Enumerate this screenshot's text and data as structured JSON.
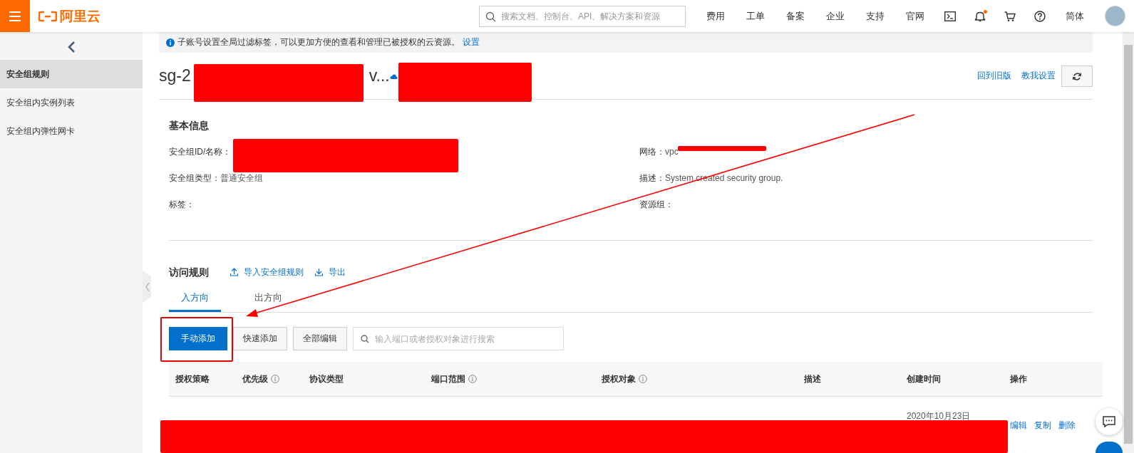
{
  "topbar": {
    "logo_text": "阿里云",
    "search": {
      "placeholder": "搜索文档、控制台、API、解决方案和资源"
    },
    "nav_links": [
      "费用",
      "工单",
      "备案",
      "企业",
      "支持",
      "官网"
    ],
    "notifications": {
      "unread": true
    },
    "language": "简体"
  },
  "sidebar": {
    "items": [
      {
        "label": "安全组规则",
        "selected": true
      },
      {
        "label": "安全组内实例列表",
        "selected": false
      },
      {
        "label": "安全组内弹性网卡",
        "selected": false
      }
    ]
  },
  "notice": {
    "text": "子账号设置全局过滤标签，可以更加方便的查看和管理已被授权的云资源。",
    "link": "设置"
  },
  "header": {
    "title_start": "sg-2",
    "title_end": "v...",
    "links": [
      "回到旧版",
      "教我设置"
    ]
  },
  "basic_info": {
    "title": "基本信息",
    "fields": [
      {
        "label": "安全组ID/名称："
      },
      {
        "label": "网络：",
        "value": "vpc"
      },
      {
        "label": "安全组类型：",
        "value": "普通安全组"
      },
      {
        "label": "描述：",
        "value": "System created security group."
      },
      {
        "label": "标签："
      },
      {
        "label": "资源组："
      }
    ]
  },
  "rules": {
    "title": "访问规则",
    "actions": [
      "导入安全组规则",
      "导出"
    ],
    "tabs": [
      {
        "label": "入方向",
        "selected": true
      },
      {
        "label": "出方向",
        "selected": false
      }
    ],
    "buttons": [
      {
        "label": "手动添加",
        "kind": "primary"
      },
      {
        "label": "快速添加",
        "kind": "normal"
      },
      {
        "label": "全部编辑",
        "kind": "normal"
      }
    ],
    "search": {
      "placeholder": "输入端口或者授权对象进行搜索"
    },
    "table": {
      "columns": [
        {
          "label": "授权策略",
          "info": false
        },
        {
          "label": "优先级",
          "info": true
        },
        {
          "label": "协议类型",
          "info": false
        },
        {
          "label": "端口范围",
          "info": true
        },
        {
          "label": "授权对象",
          "info": true
        },
        {
          "label": "描述",
          "info": false
        },
        {
          "label": "创建时间",
          "info": false
        },
        {
          "label": "操作",
          "info": false
        }
      ],
      "rows": [
        {
          "created": "2020年10月23日",
          "actions": [
            "编辑",
            "复制",
            "删除"
          ]
        }
      ]
    }
  }
}
